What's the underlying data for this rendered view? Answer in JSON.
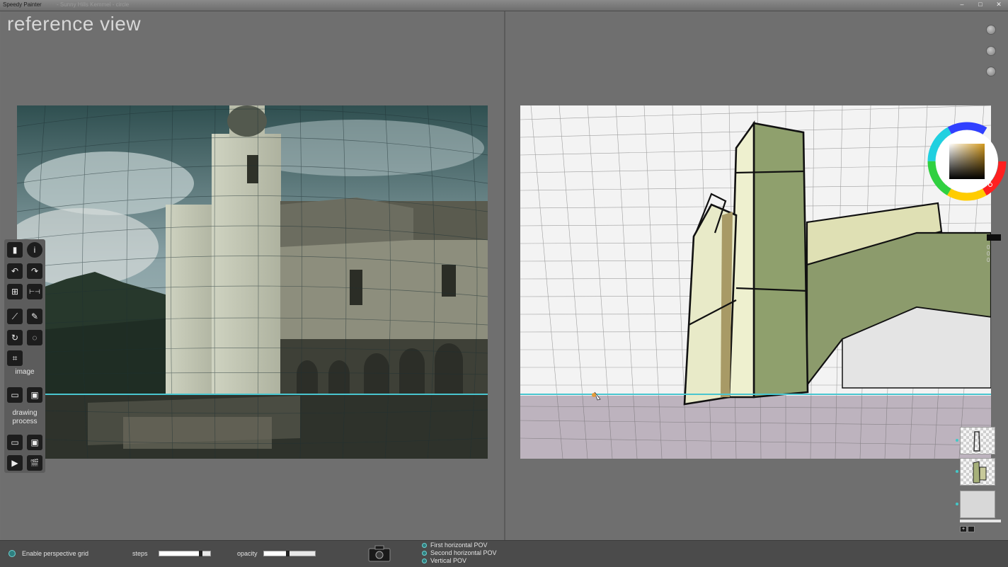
{
  "app": {
    "title": "Speedy Painter",
    "title_extra": "- Sunny Hills   Kemmel - circle",
    "window_controls": [
      "–",
      "□",
      "✕"
    ]
  },
  "reference": {
    "title": "reference view"
  },
  "toolbar": {
    "image_label": "image",
    "drawing_label": "drawing process",
    "tools": [
      {
        "name": "new-document-icon",
        "glyph": "▮"
      },
      {
        "name": "info-icon",
        "glyph": "i"
      },
      {
        "name": "undo-icon",
        "glyph": "↶"
      },
      {
        "name": "redo-icon",
        "glyph": "↷"
      },
      {
        "name": "perspective-icon",
        "glyph": "⊞"
      },
      {
        "name": "flip-icon",
        "glyph": "⊢⊣"
      },
      {
        "name": "brush-icon",
        "glyph": "⟋"
      },
      {
        "name": "pencil-icon",
        "glyph": "✎"
      },
      {
        "name": "rotate-icon",
        "glyph": "↻"
      },
      {
        "name": "lasso-icon",
        "glyph": "◌"
      },
      {
        "name": "crop-icon",
        "glyph": "⌗"
      },
      {
        "name": "image-open-icon",
        "glyph": "▭"
      },
      {
        "name": "image-save-icon",
        "glyph": "▣"
      },
      {
        "name": "drawing-open-icon",
        "glyph": "▭"
      },
      {
        "name": "drawing-save-icon",
        "glyph": "▣"
      },
      {
        "name": "play-icon",
        "glyph": "▶"
      },
      {
        "name": "clapper-icon",
        "glyph": "🎬"
      }
    ]
  },
  "side_readout": {
    "lines": [
      "0",
      "0",
      "0"
    ]
  },
  "bottom": {
    "enable_grid_label": "Enable perspective grid",
    "steps_label": "steps",
    "steps_value": 0.85,
    "opacity_label": "opacity",
    "opacity_value": 0.5,
    "pov_options": [
      "First horizontal POV",
      "Second horizontal POV",
      "Vertical POV"
    ]
  },
  "colors": {
    "horizon": "#49c5cf",
    "panel": "#6f6f6f",
    "toolbar": "#5c5c5c",
    "accent": "#43c8c8"
  }
}
